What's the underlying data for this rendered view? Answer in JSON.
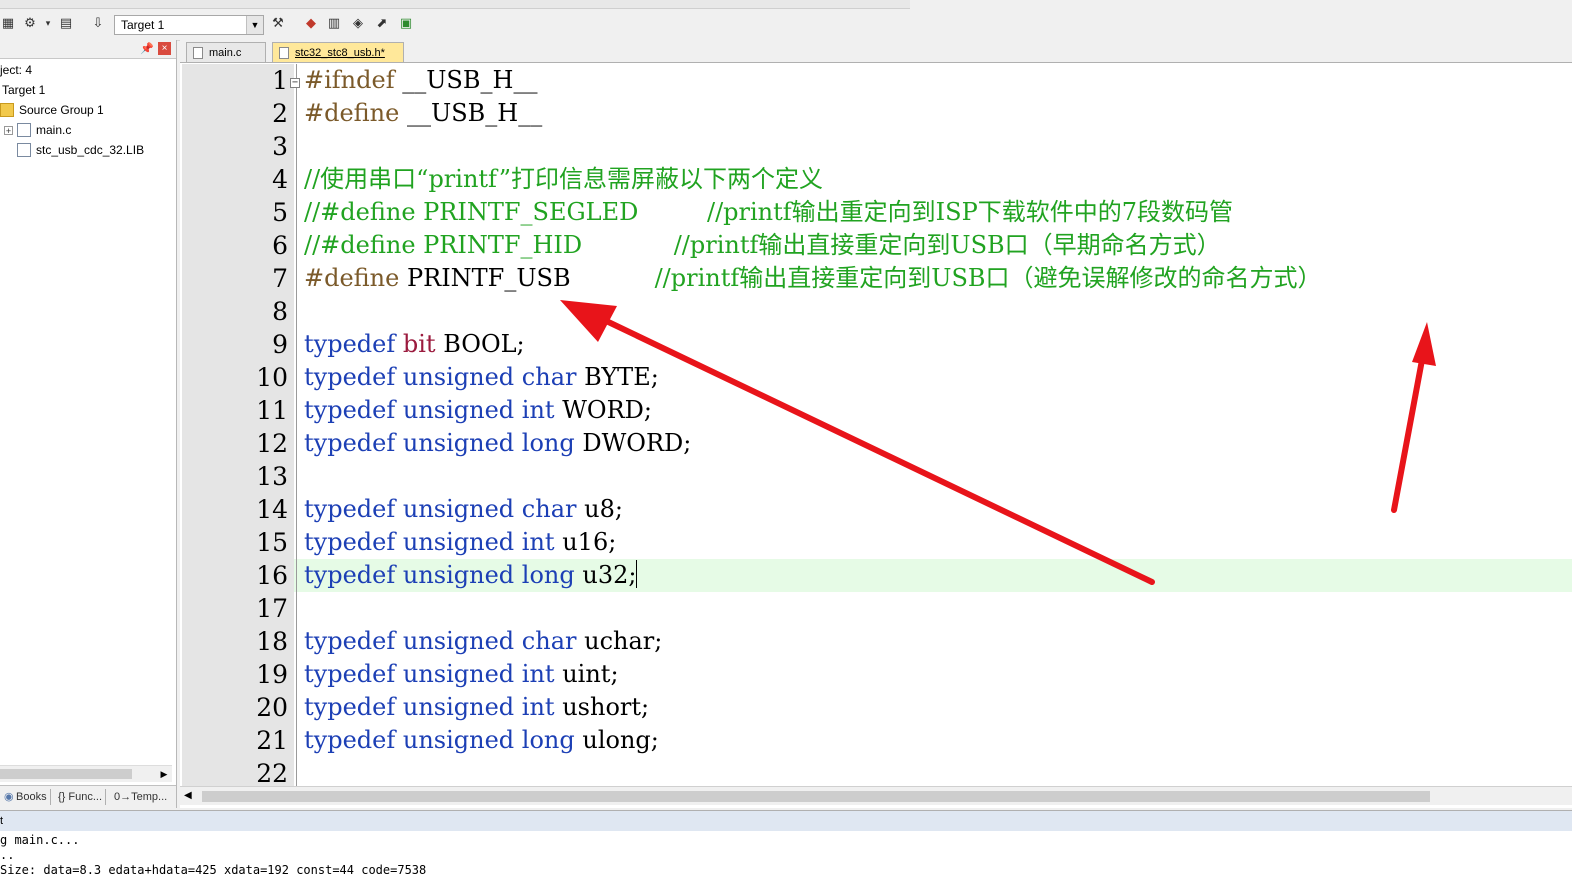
{
  "toolbar": {
    "target_value": "Target 1",
    "icons": [
      "build-icon",
      "rebuild-icon",
      "download-icon",
      "target-options-icon",
      "manage-components-icon"
    ]
  },
  "project_panel": {
    "title_partial": "ject: 4",
    "target": "Target 1",
    "group": "Source Group 1",
    "files": [
      "main.c",
      "stc_usb_cdc_32.LIB"
    ],
    "tabs": [
      "Books",
      "Func...",
      "Temp..."
    ],
    "tab_glyphs": [
      "",
      "{}",
      "0→"
    ]
  },
  "editor": {
    "tabs": [
      {
        "label": "main.c",
        "active": false
      },
      {
        "label": "stc32_stc8_usb.h*",
        "active": true
      }
    ],
    "line_numbers": [
      "1",
      "2",
      "3",
      "4",
      "5",
      "6",
      "7",
      "8",
      "9",
      "10",
      "11",
      "12",
      "13",
      "14",
      "15",
      "16",
      "17",
      "18",
      "19",
      "20",
      "21",
      "22"
    ],
    "current_line": 16,
    "lines": {
      "l1a": "#ifndef",
      "l1b": " __USB_H__",
      "l2a": "#define",
      "l2b": " __USB_H__",
      "l4": "//使用串口“printf”打印信息需屏蔽以下两个定义",
      "l5": "//#define PRINTF_SEGLED         //printf输出重定向到ISP下载软件中的7段数码管",
      "l6": "//#define PRINTF_HID            //printf输出直接重定向到USB口（早期命名方式）",
      "l7a": "#define",
      "l7b": " PRINTF_USB           ",
      "l7c": "//printf输出直接重定向到USB口（避免误解修改的命名方式）",
      "kw_typedef": "typedef",
      "kw_unsigned": "unsigned",
      "ty_bit": "bit",
      "kw_char": "char",
      "kw_int": "int",
      "kw_long": "long",
      "n9": "BOOL;",
      "n10": "BYTE;",
      "n11": "WORD;",
      "n12": "DWORD;",
      "n14": "u8;",
      "n15": "u16;",
      "n16": "u32;",
      "n18": "uchar;",
      "n19": "uint;",
      "n20": "ushort;",
      "n21": "ulong;"
    }
  },
  "output": {
    "header": "t",
    "lines": [
      "g main.c...",
      "..",
      "Size: data=8.3 edata+hdata=425 xdata=192 const=44 code=7538"
    ]
  },
  "colors": {
    "keyword": "#1c3fb5",
    "type_bit": "#9b1b3e",
    "comment": "#21a321",
    "preprocessor": "#7b5a2a",
    "current_line_bg": "#e6fbe6",
    "annotation_arrow": "#e8141a",
    "active_tab": "#ffe89a"
  }
}
